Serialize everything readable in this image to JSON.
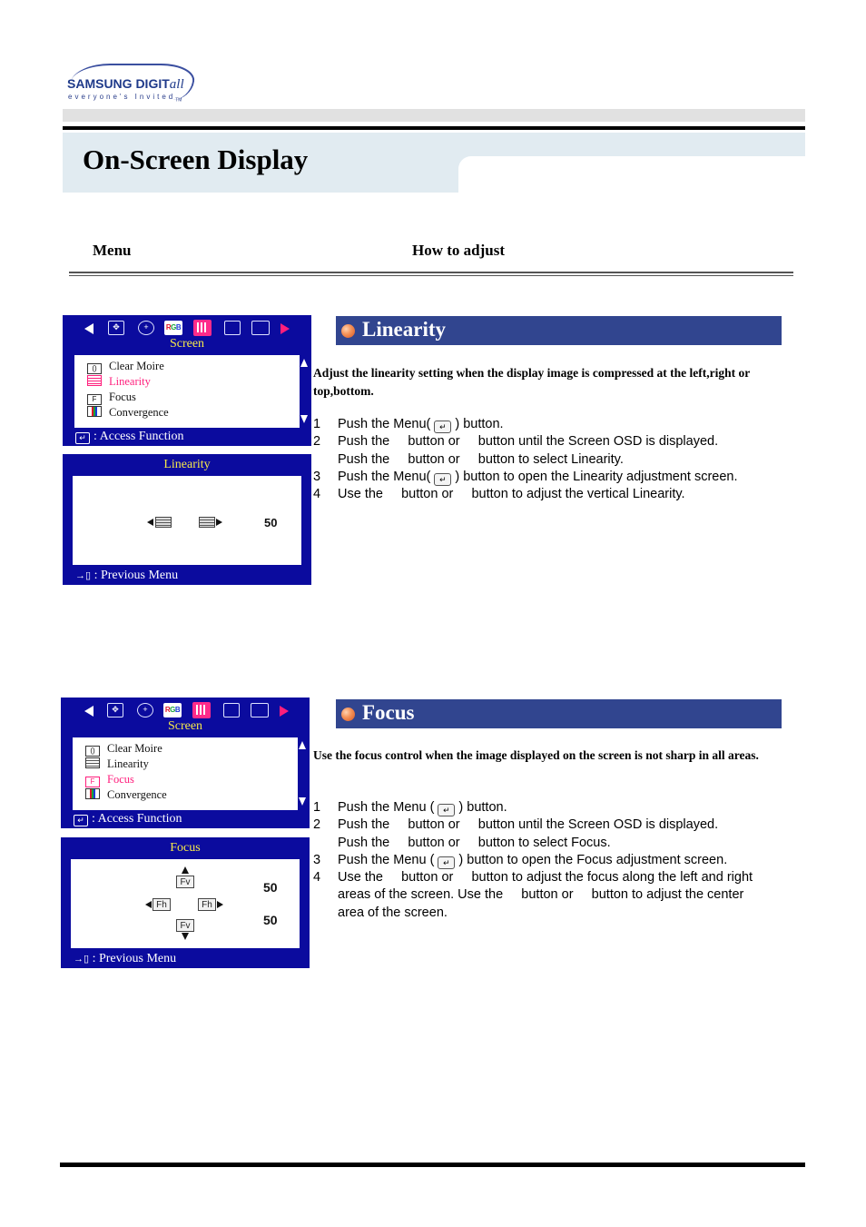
{
  "header": {
    "logo": {
      "brand": "SAMSUNG DIGIT",
      "brand_suffix": "all",
      "tagline": "everyone's Invited",
      "tm": "TM"
    },
    "page_title": "On-Screen Display"
  },
  "columns": {
    "menu": "Menu",
    "how_to_adjust": "How to adjust"
  },
  "osd_common": {
    "nav_icons": [
      "arrow-left-icon",
      "position-icon",
      "geometry-icon",
      "rgb-color-icon",
      "screen-icon",
      "multi-window-icon",
      "window-icon",
      "arrow-right-icon"
    ],
    "rgb_label": [
      "R",
      "G",
      "B"
    ],
    "menu_title": "Screen",
    "menu_items": [
      "Clear Moire",
      "Linearity",
      "Focus",
      "Convergence"
    ],
    "menu_item_icons": [
      "clear-moire-icon",
      "linearity-icon",
      "focus-icon",
      "convergence-icon"
    ],
    "focus_icon_letter": "F",
    "access_footer": "Access Function",
    "previous_footer": "Previous Menu",
    "colon": ":"
  },
  "sections": [
    {
      "id": "linearity",
      "title": "Linearity",
      "selected_item_index": 1,
      "adjust_title": "Linearity",
      "adjust_value": "50",
      "description": "Adjust the linearity setting when the display image is compressed at the left,right or top,bottom.",
      "steps": [
        {
          "num": "1",
          "text_before": "Push the Menu(",
          "text_after": ") button.",
          "has_menu_icon": true
        },
        {
          "num": "2",
          "text": "Push the     button or     button until the Screen OSD is displayed."
        },
        {
          "num": "",
          "text": "Push the     button or     button to select Linearity."
        },
        {
          "num": "3",
          "text_before": "Push the Menu(",
          "text_after": ") button to open the Linearity adjustment screen.",
          "has_menu_icon": true
        },
        {
          "num": "4",
          "text": "Use the     button or     button to adjust the vertical Linearity."
        }
      ]
    },
    {
      "id": "focus",
      "title": "Focus",
      "selected_item_index": 2,
      "adjust_title": "Focus",
      "fv_label": "Fv",
      "fh_label": "Fh",
      "adjust_values": [
        "50",
        "50"
      ],
      "description": "Use the focus control when the image displayed on the screen is not sharp in all areas.",
      "steps": [
        {
          "num": "1",
          "text_before": "Push the Menu (",
          "text_after": ") button.",
          "has_menu_icon": true
        },
        {
          "num": "2",
          "text": "Push the     button or     button until the Screen OSD is displayed."
        },
        {
          "num": "",
          "text": "Push the     button or     button to select Focus."
        },
        {
          "num": "3",
          "text_before": "Push the Menu (",
          "text_after": ") button to open the Focus adjustment screen.",
          "has_menu_icon": true
        },
        {
          "num": "4",
          "text": "Use the     button or     button to adjust the focus along the left and right"
        },
        {
          "num": "",
          "text": "areas of the screen. Use the     button or     button to adjust the center"
        },
        {
          "num": "",
          "text": "area of the screen."
        }
      ]
    }
  ],
  "colors": {
    "osd_blue": "#0b0b9e",
    "osd_title_yellow": "#f5e84a",
    "osd_highlight_pink": "#ff1e7c",
    "section_header_blue": "#31458f",
    "title_band": "#e1ebf1"
  }
}
